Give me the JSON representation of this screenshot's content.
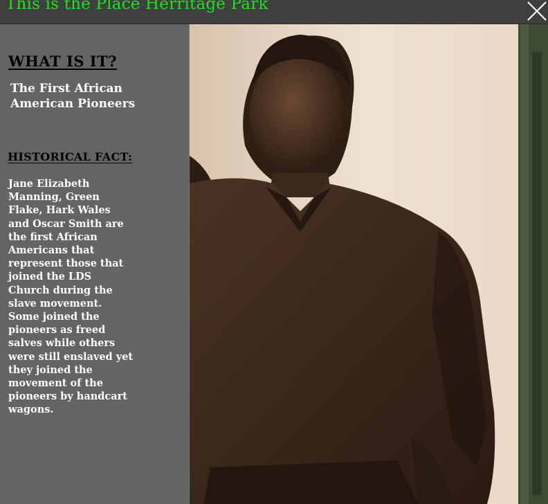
{
  "window": {
    "title": "This is the Place Herritage Park",
    "close_icon": "close-icon"
  },
  "sidebar": {
    "what_heading": "WHAT IS IT?",
    "what_text": "The First African American Pioneers",
    "fact_heading": "HISTORICAL FACT:",
    "fact_text": "Jane Elizabeth Manning, Green Flake, Hark Wales and Oscar Smith are the first African Americans that represent those that joined the LDS Church during the slave movement. Some joined the pioneers as freed salves while others were still enslaved yet they joined the movement of the pioneers by handcart wagons."
  },
  "photo": {
    "subject": "bronze-pioneer-statue"
  },
  "colors": {
    "titlebar": "#3f3f3f",
    "title_text": "#19e619",
    "sidebar": "#646464",
    "heading_text": "#000000",
    "body_text": "#ffffff"
  }
}
